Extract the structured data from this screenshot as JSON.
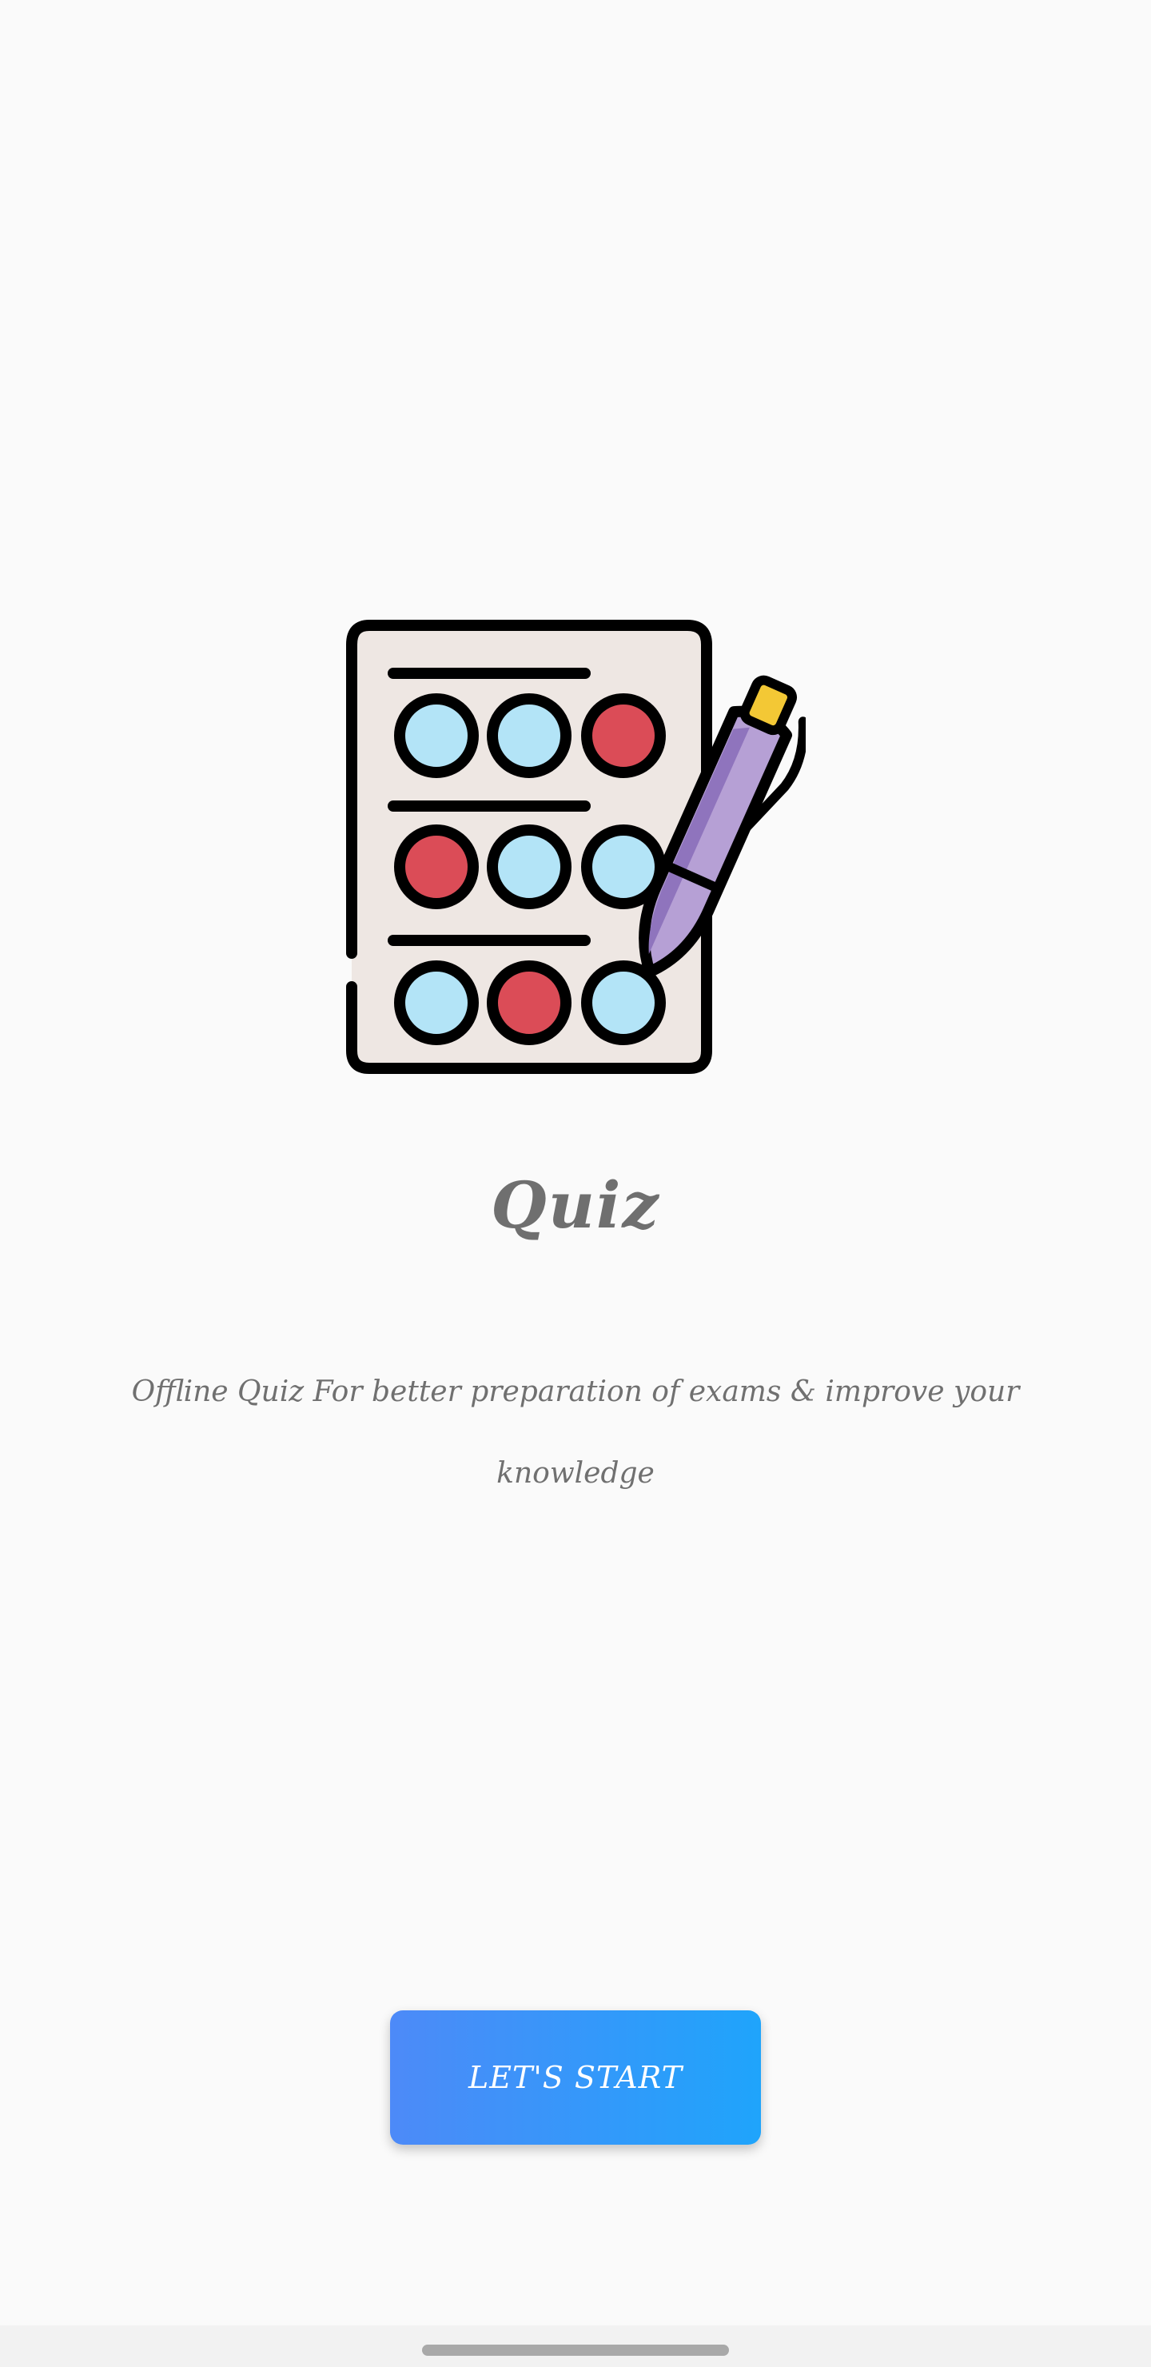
{
  "app": {
    "title": "Quiz",
    "description": "Offline Quiz For better preparation of exams & improve your knowledge"
  },
  "illustration": {
    "icon": "quiz-answer-sheet-with-pen-icon",
    "colors": {
      "sheet": "#eee7e3",
      "outline": "#000000",
      "answer_blue": "#b3e4f7",
      "answer_red": "#db4c57",
      "pen_body": "#b6a0d5",
      "pen_shade": "#8f74bd",
      "pen_cap": "#f3c835"
    }
  },
  "start_button": {
    "label": "LET'S START",
    "gradient": [
      "#4d8af8",
      "#1fa4fb"
    ]
  },
  "colors": {
    "background": "#fafafa",
    "text": "#6f6f6f",
    "nav_handle": "#a9a9a9"
  }
}
